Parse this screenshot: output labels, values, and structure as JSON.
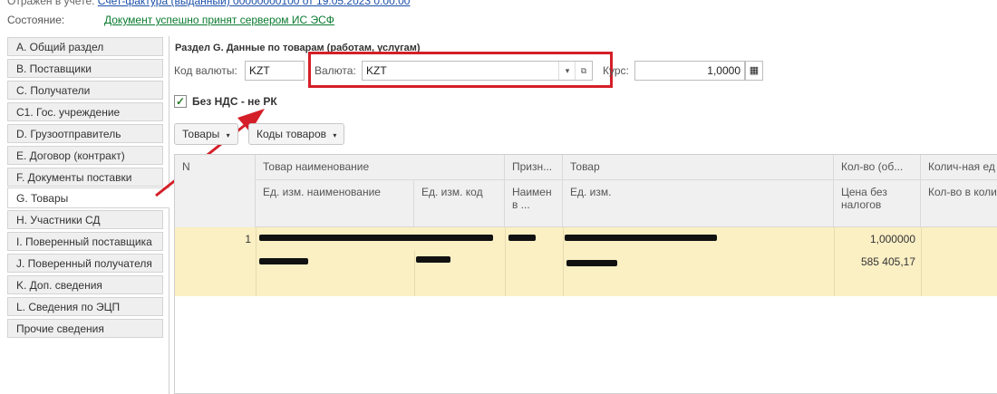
{
  "header": {
    "reflected_label": "Отражен в учете:",
    "reflected_link": "Счет-фактура (выданный) 00000000100 от 19.05.2023 0:00:00",
    "state_label": "Состояние:",
    "state_value": "Документ успешно принят сервером ИС ЭСФ"
  },
  "sidebar": {
    "items": [
      {
        "label": "A. Общий раздел"
      },
      {
        "label": "B. Поставщики"
      },
      {
        "label": "C. Получатели"
      },
      {
        "label": "C1. Гос. учреждение"
      },
      {
        "label": "D. Грузоотправитель"
      },
      {
        "label": "E. Договор (контракт)"
      },
      {
        "label": "F. Документы поставки"
      },
      {
        "label": "G. Товары"
      },
      {
        "label": "H. Участники СД"
      },
      {
        "label": "I. Поверенный поставщика"
      },
      {
        "label": "J. Поверенный получателя"
      },
      {
        "label": "K. Доп. сведения"
      },
      {
        "label": "L. Сведения по ЭЦП"
      },
      {
        "label": "Прочие сведения"
      }
    ],
    "active": "G. Товары"
  },
  "section": {
    "title": "Раздел G. Данные по товарам (работам, услугам)",
    "currency_code_label": "Код валюты:",
    "currency_code_value": "KZT",
    "currency_label": "Валюта:",
    "currency_value": "KZT",
    "rate_label": "Курс:",
    "rate_value": "1,0000",
    "no_vat_label": "Без НДС - не РК",
    "no_vat_checked": true
  },
  "toolbar": {
    "goods_button": "Товары",
    "goods_codes_button": "Коды товаров"
  },
  "table": {
    "headers_row1": [
      "N",
      "Товар наименование",
      "Призн...",
      "Товар",
      "Кол-во (об...",
      "Колич-ная ед"
    ],
    "headers_row2": [
      "Ед. изм. наименование",
      "Ед. изм. код",
      "Наимен в ...",
      "Ед. изм.",
      "Цена без налогов",
      "Кол-во в коли"
    ],
    "rows": [
      {
        "n": "1",
        "quantity": "1,000000",
        "price": "585 405,17"
      }
    ]
  },
  "colors": {
    "highlight": "#d41f28",
    "row_bg": "#fbefc4",
    "state_green": "#0a7a2f"
  }
}
